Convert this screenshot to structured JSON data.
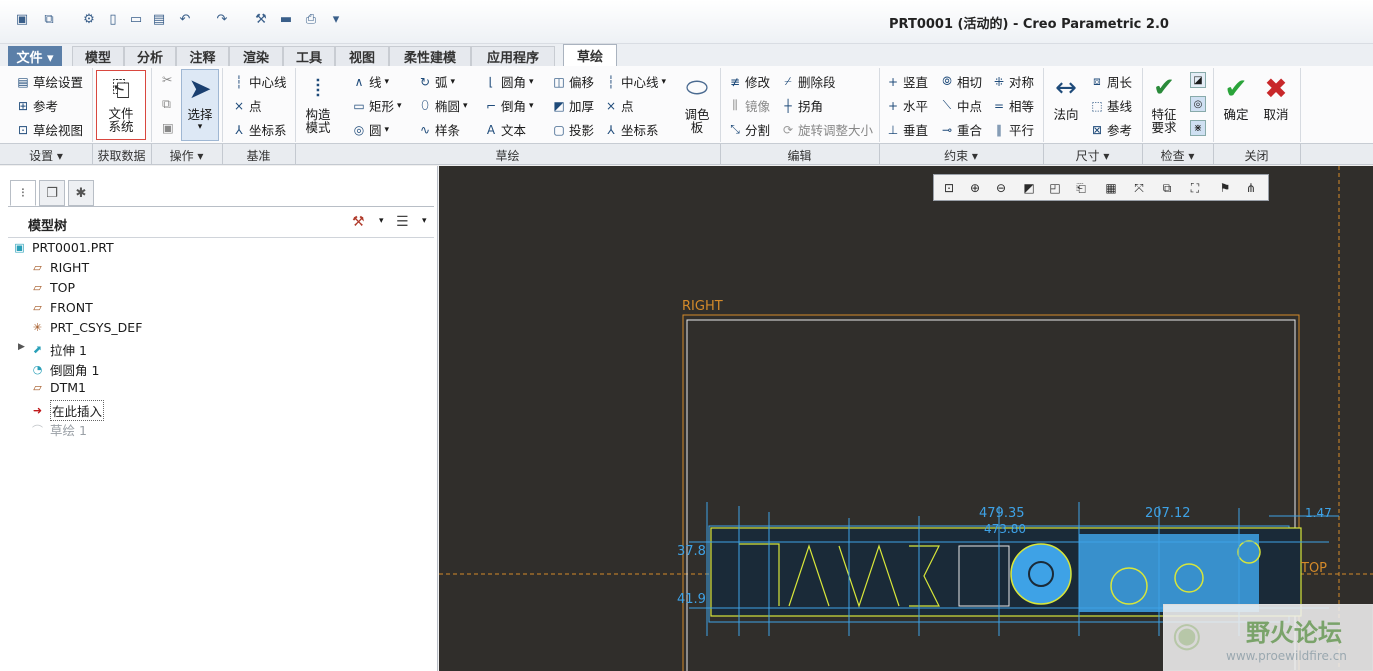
{
  "window": {
    "title": "PRT0001 (活动的) - Creo Parametric 2.0"
  },
  "quick_access": [
    "new-model-icon",
    "window-icon",
    "regenerate-icon",
    "new-icon",
    "open-icon",
    "save-icon",
    "undo-icon",
    "redo-icon",
    "redo-dropdown-icon",
    "settings-icon",
    "close-window-icon",
    "print-icon",
    "customize-icon"
  ],
  "tabs": [
    {
      "label": "文件 ▾"
    },
    {
      "label": "模型"
    },
    {
      "label": "分析"
    },
    {
      "label": "注释"
    },
    {
      "label": "渲染"
    },
    {
      "label": "工具"
    },
    {
      "label": "视图"
    },
    {
      "label": "柔性建模"
    },
    {
      "label": "应用程序"
    },
    {
      "label": "草绘"
    }
  ],
  "ribbon": {
    "setup": {
      "sketch_setup": "草绘设置",
      "references": "参考",
      "sketch_view": "草绘视图"
    },
    "get_data": {
      "file_system": "文件\n系统"
    },
    "operations": {
      "select": "选择"
    },
    "datum": {
      "centerline": "中心线",
      "point": "点",
      "csys": "坐标系"
    },
    "construction": {
      "label": "构造\n模式"
    },
    "sketch": {
      "line": "线",
      "arc": "弧",
      "fillet": "圆角",
      "offset": "偏移",
      "centerline": "中心线",
      "rectangle": "矩形",
      "ellipse": "椭圆",
      "chamfer": "倒角",
      "thicken": "加厚",
      "point": "点",
      "circle": "圆",
      "spline": "样条",
      "text": "文本",
      "project": "投影",
      "csys": "坐标系",
      "palette": "调色\n板"
    },
    "edit": {
      "modify": "修改",
      "delete_segment": "删除段",
      "mirror": "镜像",
      "corner": "拐角",
      "divide": "分割",
      "rotate_resize": "旋转调整大小"
    },
    "constrain": {
      "vertical": "竖直",
      "tangent": "相切",
      "symmetric": "对称",
      "horizontal": "水平",
      "midpoint": "中点",
      "equal": "相等",
      "perpendicular": "垂直",
      "coincident": "重合",
      "parallel": "平行"
    },
    "dimension": {
      "normal": "法向",
      "perimeter": "周长",
      "baseline": "基线",
      "reference": "参考"
    },
    "inspect": {
      "feature_requirements": "特征\n要求"
    },
    "close": {
      "ok": "确定",
      "cancel": "取消"
    }
  },
  "groups": [
    "设置 ▾",
    "获取数据",
    "操作 ▾",
    "基准",
    "草绘",
    "编辑",
    "约束 ▾",
    "尺寸 ▾",
    "检查 ▾",
    "关闭"
  ],
  "model_tree": {
    "title": "模型树",
    "items": [
      {
        "label": "PRT0001.PRT",
        "icon": "part-icon"
      },
      {
        "label": "RIGHT",
        "icon": "datum-plane-icon"
      },
      {
        "label": "TOP",
        "icon": "datum-plane-icon"
      },
      {
        "label": "FRONT",
        "icon": "datum-plane-icon"
      },
      {
        "label": "PRT_CSYS_DEF",
        "icon": "csys-icon"
      },
      {
        "label": "拉伸 1",
        "icon": "extrude-icon"
      },
      {
        "label": "倒圆角 1",
        "icon": "round-icon"
      },
      {
        "label": "DTM1",
        "icon": "datum-plane-icon"
      },
      {
        "label": "在此插入",
        "icon": "insert-here-icon"
      },
      {
        "label": "草绘 1",
        "icon": "sketch-icon"
      }
    ]
  },
  "graphics": {
    "right_label": "RIGHT",
    "top_label": "TOP",
    "dims": [
      "479.35",
      "207.12",
      "473.80",
      "37.8",
      "41.9",
      "1.47"
    ]
  },
  "watermark": {
    "title": "野火论坛",
    "url": "www.proewildfire.cn"
  },
  "colors": {
    "file_tab": "#5b7fa8",
    "graphics_bg": "#302e2b",
    "datum_orange": "#d48a2a",
    "sketch_blue": "#3ea2e6",
    "sketch_yellow": "#d8e63a",
    "ok_green": "#2aa43a",
    "cancel_red": "#c8282a"
  }
}
